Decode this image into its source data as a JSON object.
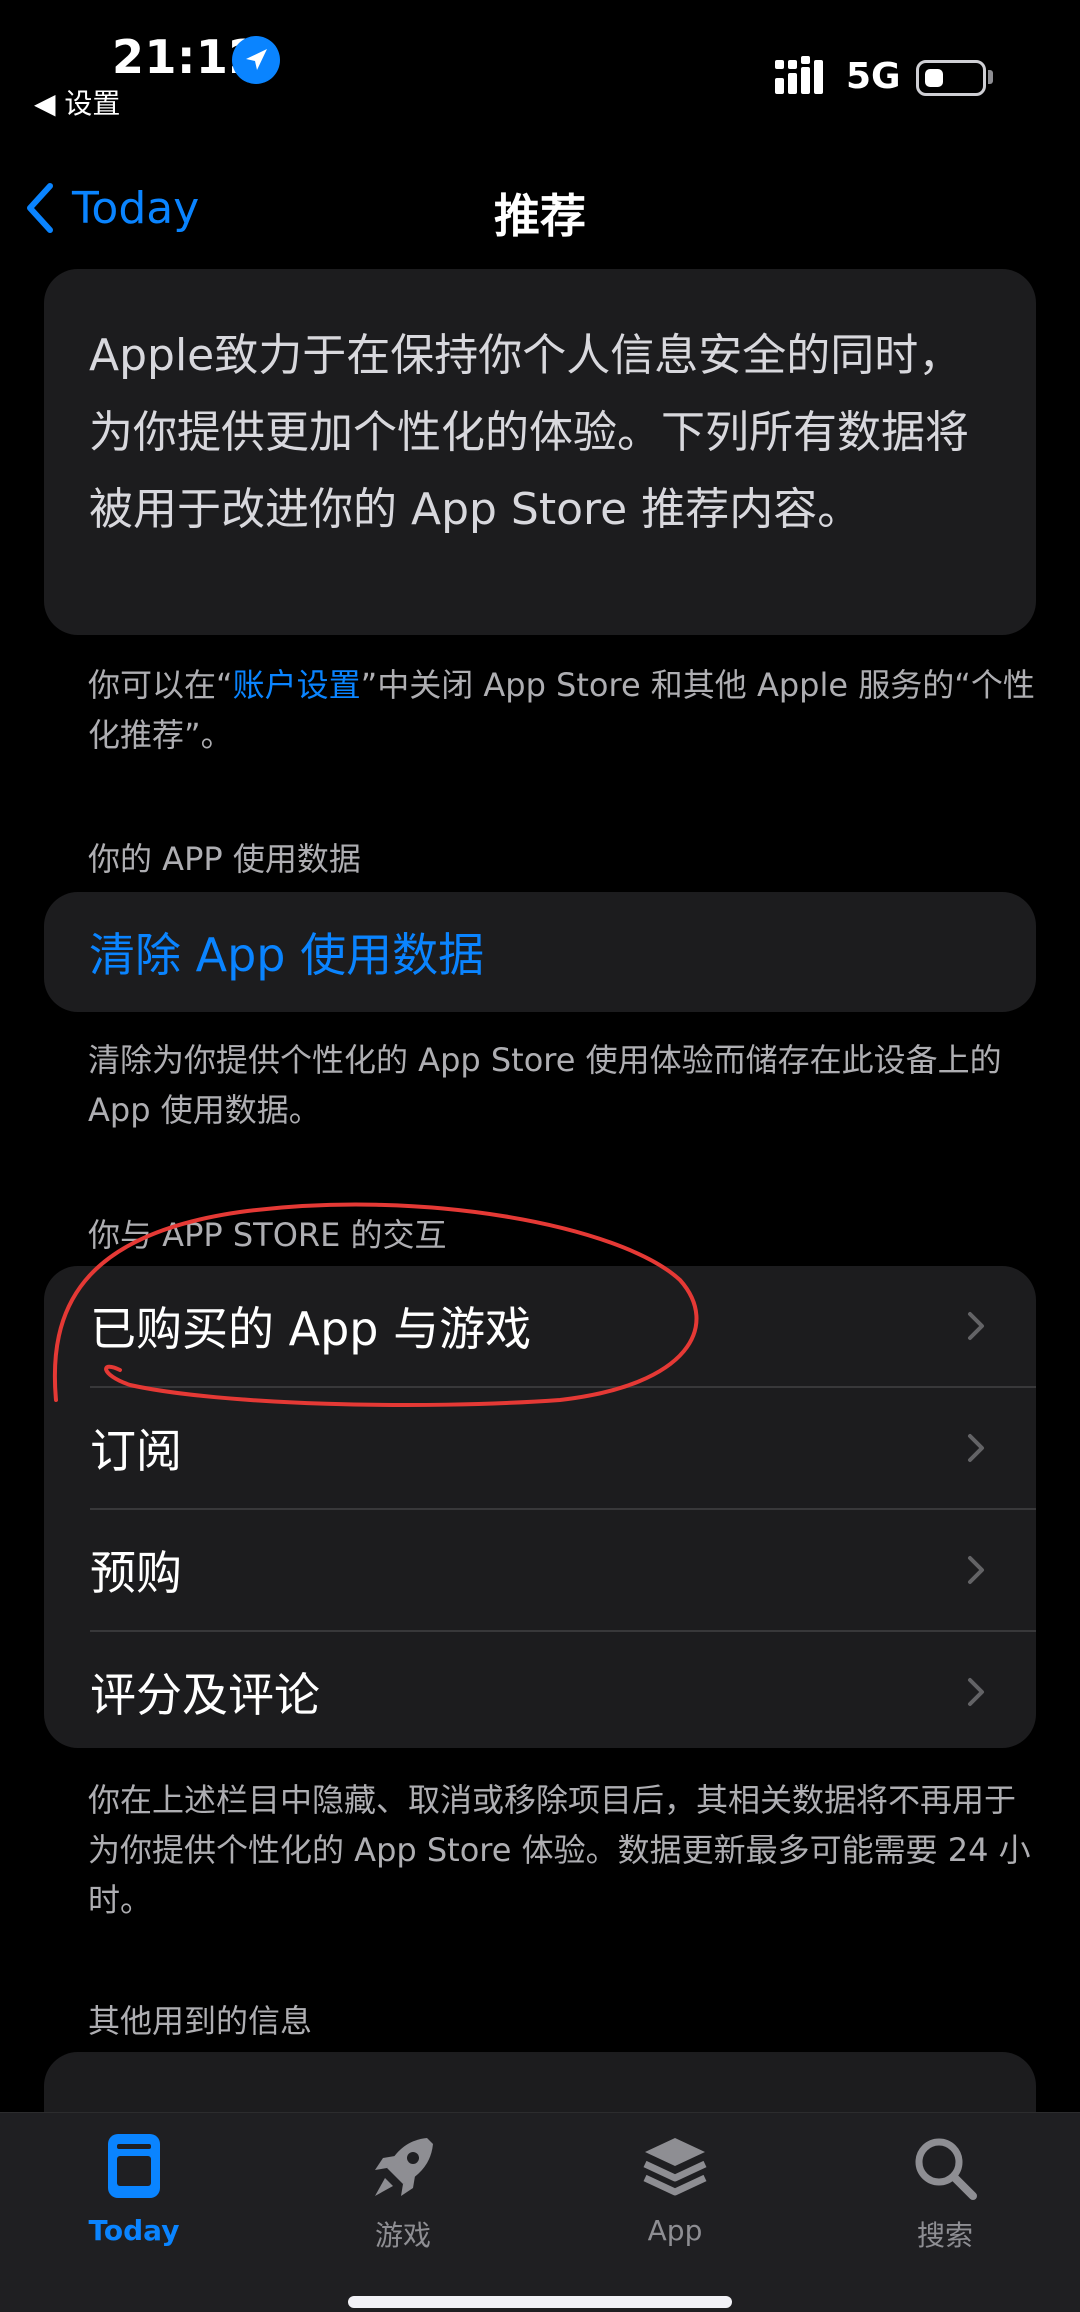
{
  "status_bar": {
    "time": "21:12",
    "back_app": "◀ 设置",
    "network": "5G"
  },
  "nav": {
    "back_label": "Today",
    "title": "推荐"
  },
  "intro": {
    "text": "Apple致力于在保持你个人信息安全的同时，为你提供更加个性化的体验。下列所有数据将被用于改进你的 App Store 推荐内容。"
  },
  "account_note": {
    "prefix": "你可以在“",
    "link": "账户设置",
    "suffix": "”中关闭 App Store 和其他 Apple 服务的“个性化推荐”。"
  },
  "usage": {
    "header": "你的 APP 使用数据",
    "clear_button": "清除 App 使用数据",
    "footnote": "清除为你提供个性化的 App Store 使用体验而储存在此设备上的 App 使用数据。"
  },
  "interactions": {
    "header": "你与 APP STORE 的交互",
    "items": [
      {
        "label": "已购买的 App 与游戏"
      },
      {
        "label": "订阅"
      },
      {
        "label": "预购"
      },
      {
        "label": "评分及评论"
      }
    ],
    "footnote": "你在上述栏目中隐藏、取消或移除项目后，其相关数据将不再用于为你提供个性化的 App Store 体验。数据更新最多可能需要 24 小时。"
  },
  "other": {
    "header": "其他用到的信息"
  },
  "tabs": [
    {
      "label": "Today",
      "active": true
    },
    {
      "label": "游戏",
      "active": false
    },
    {
      "label": "App",
      "active": false
    },
    {
      "label": "搜索",
      "active": false
    }
  ],
  "colors": {
    "accent": "#0a84ff",
    "annotation": "#e53935",
    "card": "#1c1c1e"
  }
}
